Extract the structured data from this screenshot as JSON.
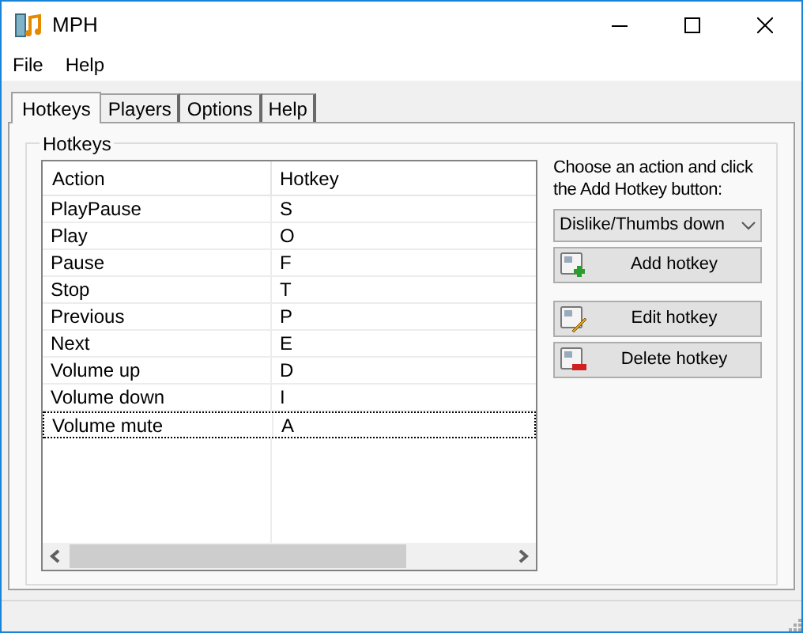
{
  "window": {
    "title": "MPH"
  },
  "menu": [
    "File",
    "Help"
  ],
  "tabs": [
    {
      "label": "Hotkeys",
      "selected": true
    },
    {
      "label": "Players",
      "selected": false
    },
    {
      "label": "Options",
      "selected": false
    },
    {
      "label": "Help",
      "selected": false
    }
  ],
  "group": {
    "title": "Hotkeys"
  },
  "table": {
    "columns": [
      "Action",
      "Hotkey"
    ],
    "rows": [
      {
        "action": "PlayPause",
        "hotkey": "S",
        "focused": false
      },
      {
        "action": "Play",
        "hotkey": "O",
        "focused": false
      },
      {
        "action": "Pause",
        "hotkey": "F",
        "focused": false
      },
      {
        "action": "Stop",
        "hotkey": "T",
        "focused": false
      },
      {
        "action": "Previous",
        "hotkey": "P",
        "focused": false
      },
      {
        "action": "Next",
        "hotkey": "E",
        "focused": false
      },
      {
        "action": "Volume up",
        "hotkey": "D",
        "focused": false
      },
      {
        "action": "Volume down",
        "hotkey": "I",
        "focused": false
      },
      {
        "action": "Volume mute",
        "hotkey": "A",
        "focused": true
      }
    ]
  },
  "instruction": "Choose an action and click the Add Hotkey button:",
  "action_select": {
    "value": "Dislike/Thumbs down"
  },
  "buttons": [
    {
      "label": "Add hotkey",
      "kind": "add"
    },
    {
      "label": "Edit hotkey",
      "kind": "edit"
    },
    {
      "label": "Delete hotkey",
      "kind": "delete"
    }
  ]
}
